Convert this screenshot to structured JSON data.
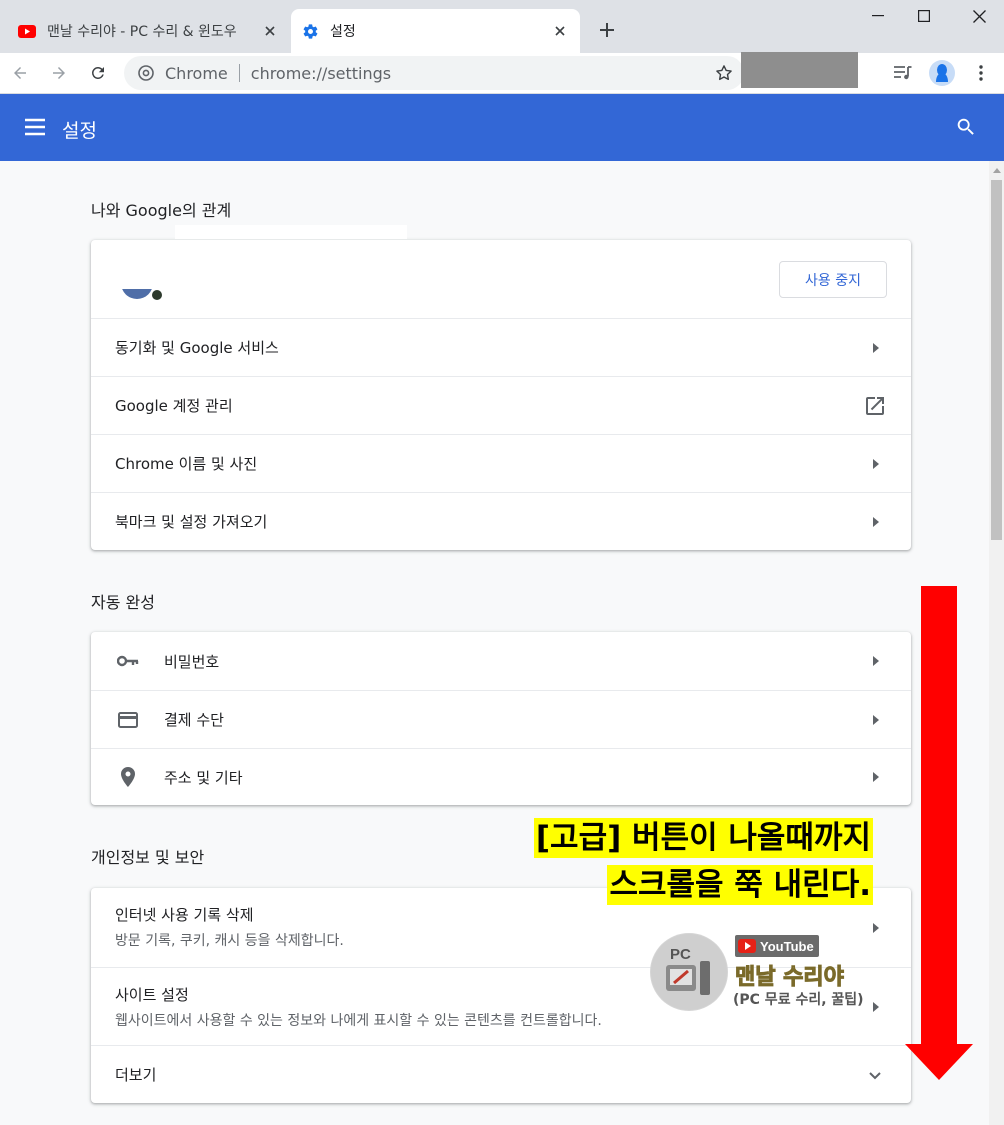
{
  "browser": {
    "tabs": [
      {
        "title": "맨날 수리야 - PC 수리 & 윈도우",
        "icon": "youtube-icon",
        "active": false
      },
      {
        "title": "설정",
        "icon": "gear-icon",
        "active": true
      }
    ],
    "omnibox": {
      "chip": "Chrome",
      "url": "chrome://settings"
    }
  },
  "header": {
    "title": "설정"
  },
  "sections": {
    "google": {
      "title": "나와 Google의 관계",
      "stop_button": "사용 중지",
      "rows": [
        "동기화 및 Google 서비스",
        "Google 계정 관리",
        "Chrome 이름 및 사진",
        "북마크 및 설정 가져오기"
      ]
    },
    "autofill": {
      "title": "자동 완성",
      "rows": [
        {
          "label": "비밀번호",
          "icon": "key-icon"
        },
        {
          "label": "결제 수단",
          "icon": "credit-card-icon"
        },
        {
          "label": "주소 및 기타",
          "icon": "location-pin-icon"
        }
      ]
    },
    "privacy": {
      "title": "개인정보 및 보안",
      "rows": [
        {
          "label": "인터넷 사용 기록 삭제",
          "sub": "방문 기록, 쿠키, 캐시 등을 삭제합니다."
        },
        {
          "label": "사이트 설정",
          "sub": "웹사이트에서 사용할 수 있는 정보와 나에게 표시할 수 있는 콘텐츠를 컨트롤합니다."
        }
      ],
      "more": "더보기"
    }
  },
  "annotation": {
    "line1": "[고급] 버튼이 나올때까지",
    "line2": "스크롤을 쭉 내린다.",
    "arrow_color": "#ff0000",
    "highlight_color": "#ffff00"
  },
  "watermark": {
    "youtube": "YouTube",
    "name": "맨날 수리야",
    "sub": "(PC 무료 수리, 꿀팁)",
    "badge": "PC 수리야"
  },
  "colors": {
    "header": "#3367d6",
    "accent": "#3367d6"
  }
}
